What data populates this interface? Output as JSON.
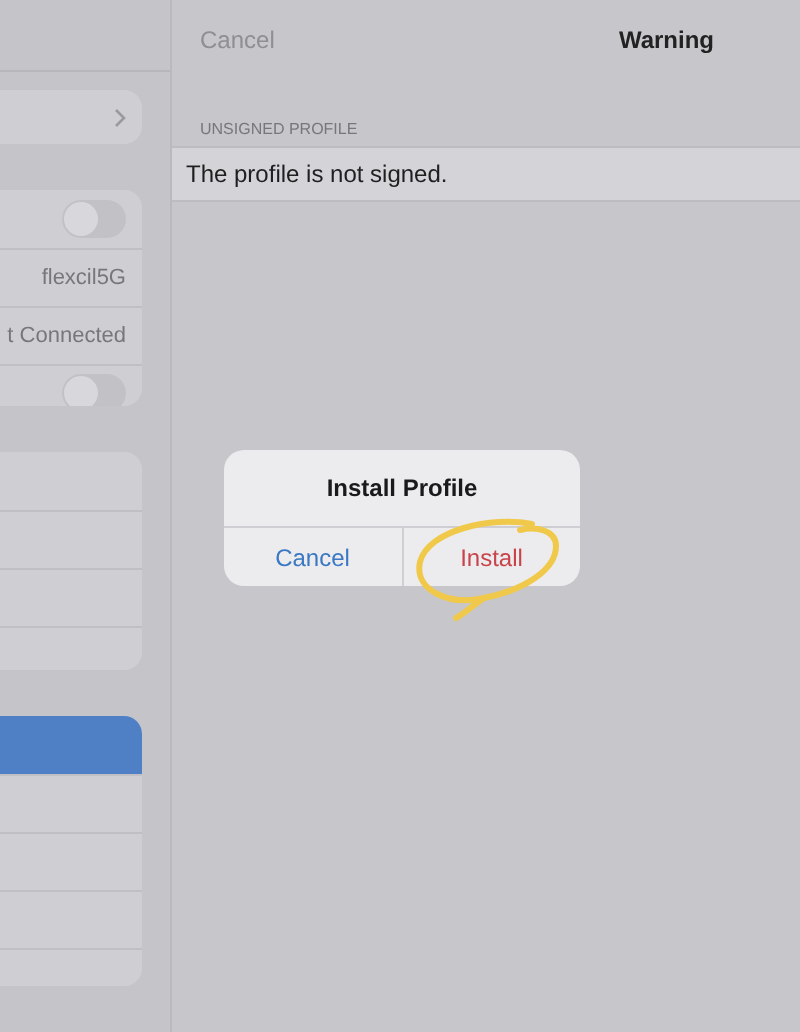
{
  "sidebar": {
    "groups": [
      {
        "rows": [
          {
            "kind": "chevron",
            "selected": false
          }
        ]
      },
      {
        "rows": [
          {
            "kind": "toggle",
            "on": false,
            "selected": false
          },
          {
            "kind": "value",
            "value": "flexcil5G",
            "selected": false
          },
          {
            "kind": "value",
            "value": "t Connected",
            "selected": false
          },
          {
            "kind": "toggle",
            "on": false,
            "selected": false
          }
        ]
      },
      {
        "rows": [
          {
            "kind": "plain",
            "selected": false
          },
          {
            "kind": "plain",
            "selected": false
          },
          {
            "kind": "plain",
            "selected": false
          },
          {
            "kind": "plain",
            "selected": false
          }
        ]
      },
      {
        "rows": [
          {
            "kind": "plain",
            "selected": true
          },
          {
            "kind": "plain",
            "selected": false
          },
          {
            "kind": "plain",
            "selected": false
          },
          {
            "kind": "plain",
            "selected": false
          },
          {
            "kind": "plain",
            "selected": false
          }
        ]
      }
    ]
  },
  "nav": {
    "cancel": "Cancel",
    "title": "Warning"
  },
  "section": {
    "header": "UNSIGNED PROFILE",
    "text": "The profile is not signed."
  },
  "alert": {
    "title": "Install Profile",
    "buttons": [
      {
        "label": "Cancel",
        "kind": "cancel"
      },
      {
        "label": "Install",
        "kind": "destructive"
      }
    ]
  }
}
